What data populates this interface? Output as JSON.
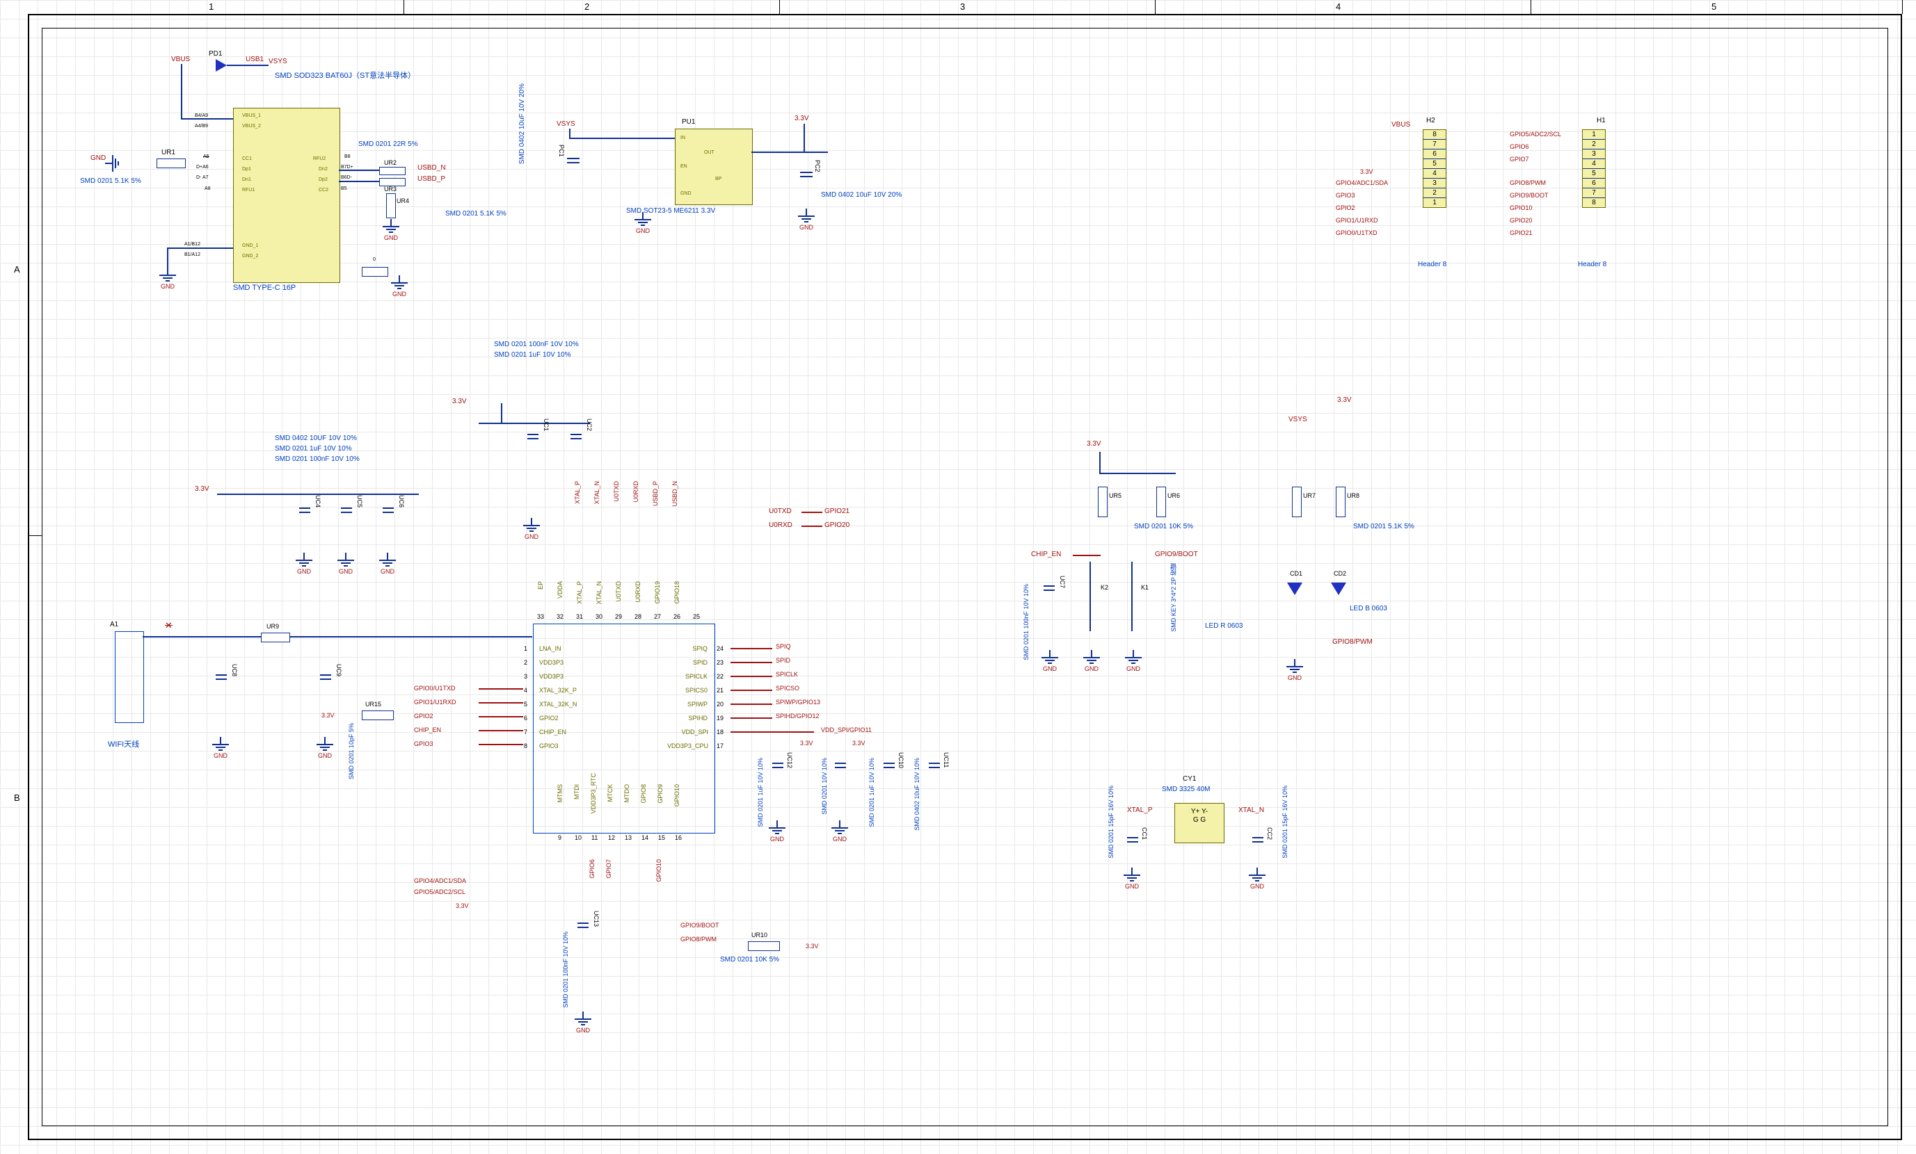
{
  "frame": {
    "cols": [
      "1",
      "2",
      "3",
      "4",
      "5"
    ],
    "rows": [
      "A",
      "B"
    ]
  },
  "power": {
    "gnd": "GND",
    "vbus": "VBUS",
    "vsys": "VSYS",
    "v33": "3.3V",
    "usb1": "USB1"
  },
  "usb": {
    "block": "SMD TYPE-C 16P",
    "pins": {
      "vbus1": "VBUS_1",
      "vbus2": "VBUS_2",
      "cc1": "CC1",
      "cc2": "CC2",
      "dp1": "Dp1",
      "dp2": "Dp2",
      "dn1": "Dn1",
      "dn2": "Dn2",
      "rfu1": "RFU1",
      "rfu2": "RFU2",
      "gnd1": "GND_1",
      "gnd2": "GND_2"
    },
    "leftpins": {
      "b4a9": "B4/A9",
      "a4b9": "A4/B9",
      "a5": "A5",
      "da6": "D+A6",
      "da7": "D- A7",
      "a8": "A8",
      "a1b12": "A1/B12",
      "b1a12": "B1/A12"
    },
    "rightpins": {
      "b8": "B8",
      "b7d": "B7D+",
      "b6d": "B6D-",
      "b5": "B5"
    },
    "diode": "SMD SOD323 BAT60J（ST意法半导体）",
    "pd1": "PD1",
    "ur": {
      "ur1": "UR1",
      "ur2": "UR2",
      "ur3": "UR3",
      "ur4": "UR4",
      "ur5": "UR5",
      "ur6": "UR6",
      "ur7": "UR7",
      "ur8": "UR8",
      "ur9": "UR9",
      "ur10": "UR10",
      "ur15": "UR15"
    },
    "res22": "SMD 0201 22R 5%",
    "res51k": "SMD 0201 5.1K 5%",
    "o0": "0"
  },
  "nets": {
    "usbd_n": "USBD_N",
    "usbd_p": "USBD_P",
    "gpio0": "GPIO0/U1TXD",
    "gpio1": "GPIO1/U1RXD",
    "gpio2": "GPIO2",
    "gpio3": "GPIO3",
    "gpio4": "GPIO4/ADC1/SDA",
    "gpio5": "GPIO5/ADC2/SCL",
    "gpio6": "GPIO6",
    "gpio7": "GPIO7",
    "gpio8": "GPIO8/PWM",
    "gpio9": "GPIO9/BOOT",
    "gpio10": "GPIO10",
    "gpio11": "VDD_SPI/GPIO11",
    "gpio12": "SPIHD/GPIO12",
    "gpio13": "SPIWP/GPIO13",
    "gpio20": "GPIO20",
    "gpio21": "GPIO21",
    "chip_en": "CHIP_EN",
    "xtal_p": "XTAL_P",
    "xtal_n": "XTAL_N",
    "spiq": "SPIQ",
    "spid": "SPID",
    "spiclk": "SPICLK",
    "spicso": "SPICSO",
    "spiwp": "SPIWP",
    "spihd": "SPIHD",
    "u0txd": "U0TXD",
    "u0rxd": "U0RXD"
  },
  "reg": {
    "pu1": "PU1",
    "in": "IN",
    "out": "OUT",
    "en": "EN",
    "bp": "BP",
    "gnd": "GND",
    "part": "SMD SOT23-5 ME6211 3.3V",
    "pc": {
      "pc1": "PC1",
      "pc2": "PC2"
    },
    "cap": "SMD 0402 10uF 10V 20%"
  },
  "mcu_caps": {
    "uc1": "UC1",
    "uc2": "UC2",
    "uc4": "UC4",
    "uc5": "UC5",
    "uc6": "UC6",
    "uc7": "UC7",
    "uc8": "UC8",
    "uc9": "UC9",
    "uc10": "UC10",
    "uc11": "UC11",
    "uc12": "UC12",
    "uc13": "UC13",
    "c0402_10u": "SMD 0402 10uF 10V 20%",
    "c0201_1u": "SMD 0201 1uF 10V 10%",
    "c0201_100n": "SMD 0201 100nF 10V 10%",
    "list_top": {
      "l1": "SMD 0201 100nF 10V 10%",
      "l2": "SMD 0201 1uF 10V 10%"
    },
    "list_left": {
      "l1": "SMD 0402 10UF 10V 10%",
      "l2": "SMD 0201 1uF 10V 10%",
      "l3": "SMD 0201 100nF 10V 10%"
    },
    "c0402_10u_v": "SMD 0402 10uF 10V 10%",
    "c0201_10_v": "SMD 0201 10V 10%",
    "c0201_1u_v": "SMD 0201 1uF 10V 10%",
    "c0201_100n_v": "SMD 0201 100nF 10V 10%",
    "c0201_100n_v2": "SMD 0201 100nF 10V 10%",
    "r0201_10pf": "SMD 0201 10pF 5%"
  },
  "mcu": {
    "top": {
      "p33": "33",
      "p32": "32",
      "p31": "31",
      "p30": "30",
      "p29": "29",
      "p28": "28",
      "p27": "27",
      "p26": "26",
      "p25": "25",
      "ep": "EP",
      "vdda": "VDDA",
      "xtal_p": "XTAL_P",
      "xtal_n": "XTAL_N",
      "u0txd": "U0TXD",
      "u0rxd": "U0RXD",
      "gpio19": "GPIO19",
      "gpio18": "GPIO18"
    },
    "left": {
      "p1": "1",
      "p2": "2",
      "p3": "3",
      "p4": "4",
      "p5": "5",
      "p6": "6",
      "p7": "7",
      "p8": "8",
      "lna": "LNA_IN",
      "vdd3p3a": "VDD3P3",
      "vdd3p3b": "VDD3P3",
      "xtal32p": "XTAL_32K_P",
      "xtal32n": "XTAL_32K_N",
      "gpio2": "GPIO2",
      "chip_en": "CHIP_EN",
      "gpio3": "GPIO3"
    },
    "right": {
      "p24": "24",
      "p23": "23",
      "p22": "22",
      "p21": "21",
      "p20": "20",
      "p19": "19",
      "p18": "18",
      "p17": "17",
      "spiq": "SPIQ",
      "spid": "SPID",
      "spiclk": "SPICLK",
      "spics0": "SPICS0",
      "spiwp": "SPIWP",
      "spihd": "SPIHD",
      "vddspi": "VDD_SPI",
      "vdd3p3cpu": "VDD3P3_CPU"
    },
    "bottom": {
      "p9": "9",
      "p10": "10",
      "p11": "11",
      "p12": "12",
      "p13": "13",
      "p14": "14",
      "p15": "15",
      "p16": "16",
      "mtms": "MTMS",
      "mtdi": "MTDI",
      "vdd3p3rtc": "VDD3P3_RTC",
      "mtck": "MTCK",
      "mtdo": "MTDO",
      "gpio8": "GPIO8",
      "gpio9": "GPIO9",
      "gpio10": "GPIO10"
    }
  },
  "ant": {
    "a1": "A1",
    "wifi": "WIFI天线"
  },
  "buttons": {
    "k1": "K1",
    "k2": "K2",
    "key": "SMD KEY 3*4*2 2P 按键",
    "r10k": "SMD 0201 10K 5%",
    "r51k": "SMD 0201 5.1K 5%",
    "cd1": "CD1",
    "cd2": "CD2",
    "ledr": "LED R 0603",
    "ledb": "LED B 0603"
  },
  "crystal": {
    "cy1": "CY1",
    "part": "SMD 3325 40M",
    "yy": "Y+ Y-",
    "gg": "G   G",
    "cc1": "CC1",
    "cc2": "CC2",
    "c15p": "SMD 0201 15pF 16V 10%"
  },
  "headers": {
    "h1": "H1",
    "h2": "H2",
    "name": "Header 8",
    "h2_pins": [
      "8",
      "7",
      "6",
      "5",
      "4",
      "3",
      "2",
      "1"
    ],
    "h1_pins": [
      "1",
      "2",
      "3",
      "4",
      "5",
      "6",
      "7",
      "8"
    ],
    "h2_nets": [
      "VBUS",
      "",
      "3.3V",
      "GPIO4/ADC1/SDA",
      "GPIO3",
      "GPIO2",
      "GPIO1/U1RXD",
      "GPIO0/U1TXD"
    ],
    "h1_nets": [
      "GPIO5/ADC2/SCL",
      "GPIO6",
      "GPIO7",
      "GPIO8/PWM",
      "GPIO9/BOOT",
      "GPIO10",
      "GPIO20",
      "GPIO21"
    ]
  },
  "netlabels_right": {
    "u0txd": "U0TXD",
    "u0rxd": "U0RXD"
  },
  "boot_pu": {
    "r10k": "SMD 0201 10K 5%"
  }
}
